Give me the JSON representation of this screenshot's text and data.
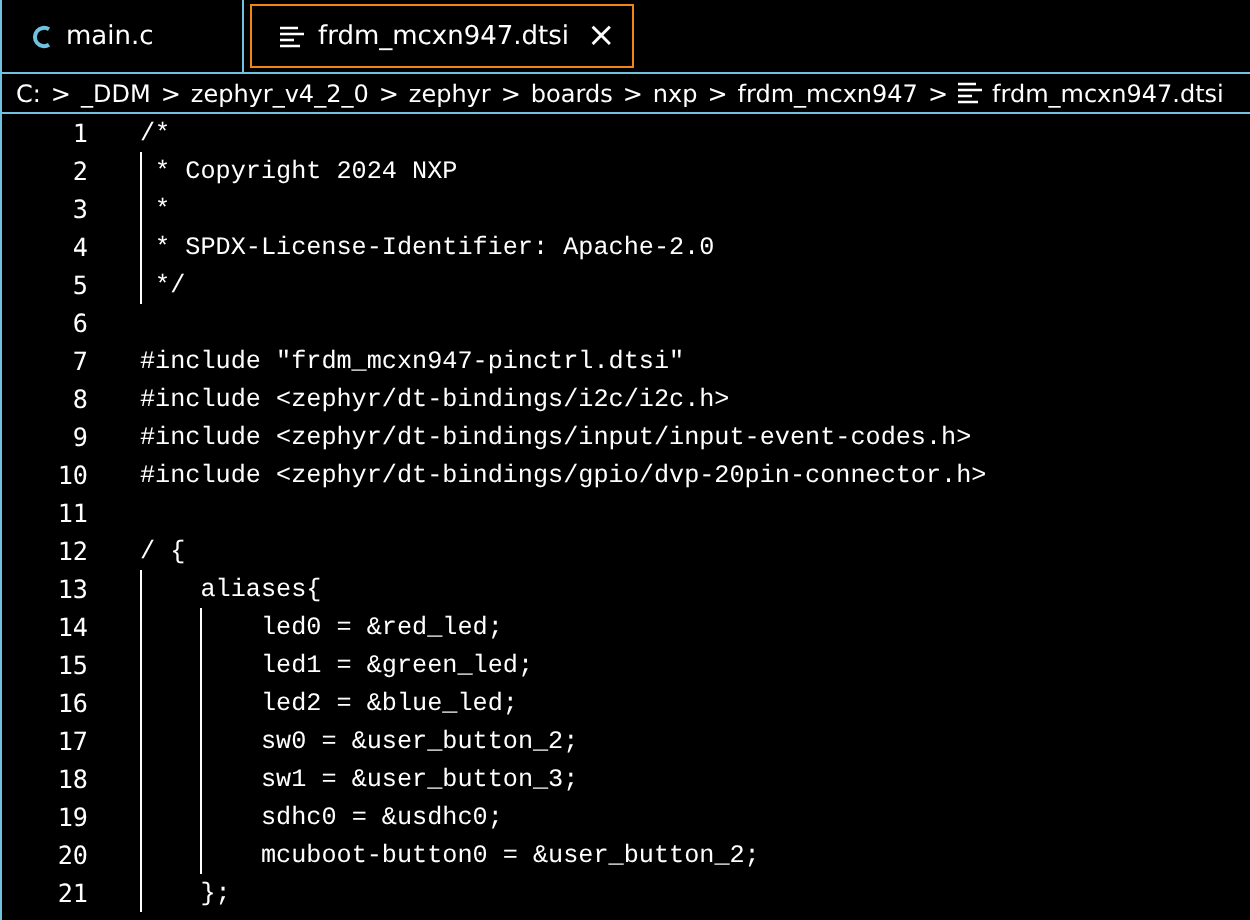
{
  "tabs": [
    {
      "label": "main.c",
      "kind": "c-file",
      "selected": false
    },
    {
      "label": "frdm_mcxn947.dtsi",
      "kind": "text-file",
      "selected": true
    }
  ],
  "close_glyph": "×",
  "breadcrumb": {
    "separator": ">",
    "items": [
      "C:",
      "_DDM",
      "zephyr_v4_2_0",
      "zephyr",
      "boards",
      "nxp",
      "frdm_mcxn947",
      "frdm_mcxn947.dtsi"
    ]
  },
  "editor": {
    "lines": [
      {
        "number": "1",
        "text": "/*"
      },
      {
        "number": "2",
        "text": " * Copyright 2024 NXP"
      },
      {
        "number": "3",
        "text": " *"
      },
      {
        "number": "4",
        "text": " * SPDX-License-Identifier: Apache-2.0"
      },
      {
        "number": "5",
        "text": " */"
      },
      {
        "number": "6"
      },
      {
        "number": "7",
        "text": "#include \"frdm_mcxn947-pinctrl.dtsi\""
      },
      {
        "number": "8",
        "text": "#include <zephyr/dt-bindings/i2c/i2c.h>"
      },
      {
        "number": "9",
        "text": "#include <zephyr/dt-bindings/input/input-event-codes.h>"
      },
      {
        "number": "10",
        "text": "#include <zephyr/dt-bindings/gpio/dvp-20pin-connector.h>"
      },
      {
        "number": "11"
      },
      {
        "number": "12",
        "text": "/ {"
      },
      {
        "number": "13",
        "text": "    aliases{"
      },
      {
        "number": "14",
        "text": "        led0 = &red_led;"
      },
      {
        "number": "15",
        "text": "        led1 = &green_led;"
      },
      {
        "number": "16",
        "text": "        led2 = &blue_led;"
      },
      {
        "number": "17",
        "text": "        sw0 = &user_button_2;"
      },
      {
        "number": "18",
        "text": "        sw1 = &user_button_3;"
      },
      {
        "number": "19",
        "text": "        sdhc0 = &usdhc0;"
      },
      {
        "number": "20",
        "text": "        mcuboot-button0 = &user_button_2;"
      },
      {
        "number": "21",
        "text": "    };"
      }
    ]
  }
}
